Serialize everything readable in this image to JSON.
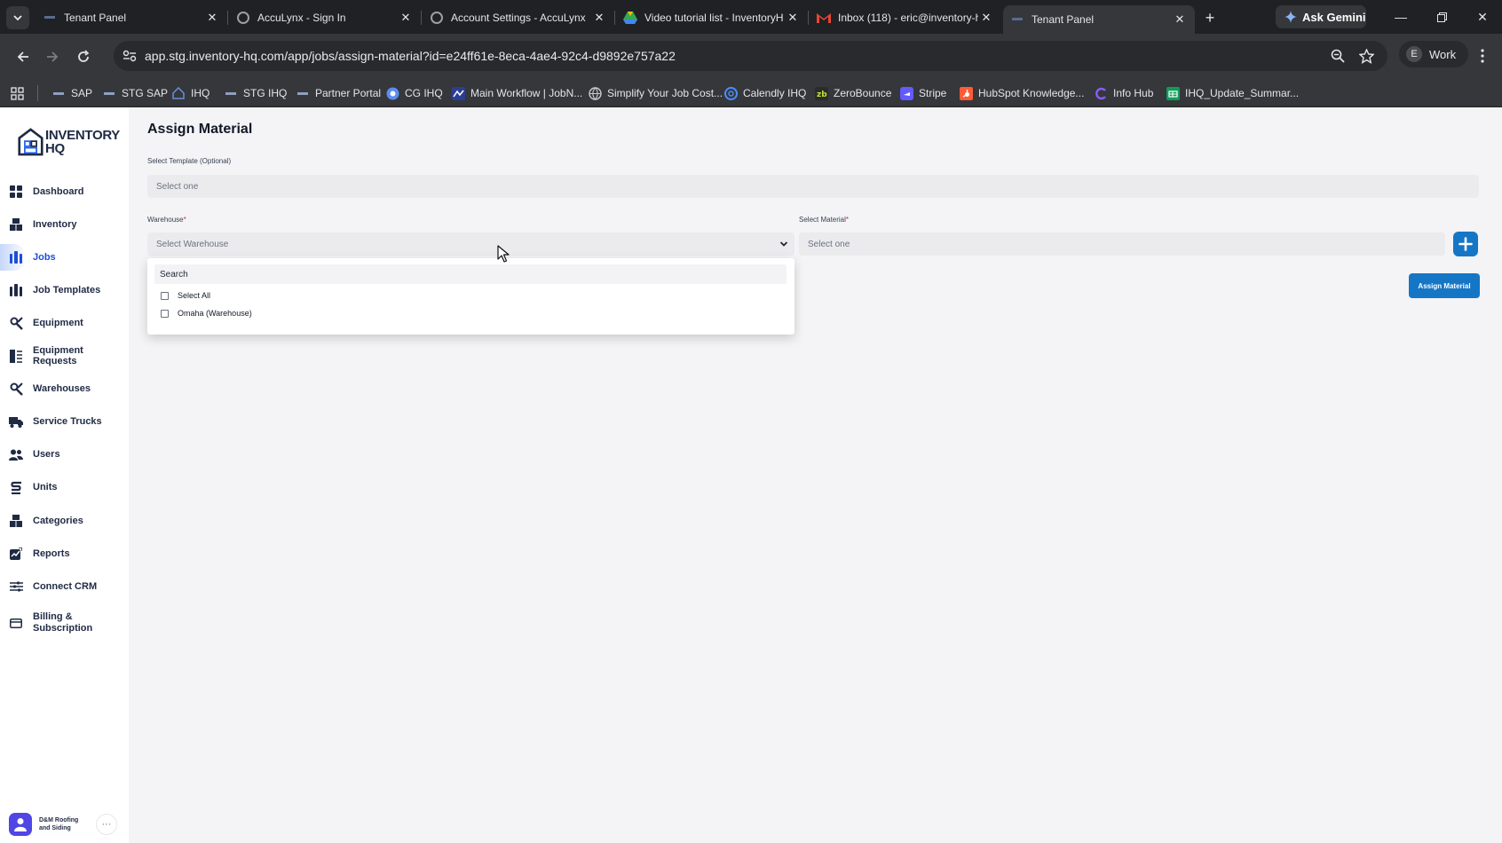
{
  "browser": {
    "tabs": [
      {
        "title": "Tenant Panel",
        "active": false
      },
      {
        "title": "AccuLynx - Sign In",
        "active": false
      },
      {
        "title": "Account Settings - AccuLynx",
        "active": false
      },
      {
        "title": "Video tutorial list - InventoryH",
        "active": false
      },
      {
        "title": "Inbox (118) - eric@inventory-h",
        "active": false
      },
      {
        "title": "Tenant Panel",
        "active": true
      }
    ],
    "gemini_label": "Ask Gemini",
    "url": "app.stg.inventory-hq.com/app/jobs/assign-material?id=e24ff61e-8eca-4ae4-92c4-d9892e757a22",
    "profile_initial": "E",
    "profile_label": "Work",
    "bookmarks": [
      "SAP",
      "STG SAP",
      "IHQ",
      "STG IHQ",
      "Partner Portal",
      "CG IHQ",
      "Main Workflow | JobN...",
      "Simplify Your Job Cost...",
      "Calendly IHQ",
      "ZeroBounce",
      "Stripe",
      "HubSpot Knowledge...",
      "Info Hub",
      "IHQ_Update_Summar..."
    ]
  },
  "sidebar": {
    "logo_line1": "INVENTORY",
    "logo_line2": "HQ",
    "items": [
      {
        "label": "Dashboard",
        "icon": "grid-icon"
      },
      {
        "label": "Inventory",
        "icon": "boxes-icon"
      },
      {
        "label": "Jobs",
        "icon": "jobs-icon",
        "active": true
      },
      {
        "label": "Job Templates",
        "icon": "templates-icon"
      },
      {
        "label": "Equipment",
        "icon": "tools-icon"
      },
      {
        "label": "Equipment Requests",
        "icon": "requests-icon"
      },
      {
        "label": "Warehouses",
        "icon": "warehouse-icon"
      },
      {
        "label": "Service Trucks",
        "icon": "truck-icon"
      },
      {
        "label": "Users",
        "icon": "users-icon"
      },
      {
        "label": "Units",
        "icon": "units-icon"
      },
      {
        "label": "Categories",
        "icon": "categories-icon"
      },
      {
        "label": "Reports",
        "icon": "reports-icon"
      },
      {
        "label": "Connect CRM",
        "icon": "crm-icon"
      },
      {
        "label": "Billing & Subscription",
        "icon": "billing-icon"
      }
    ],
    "tenant_name": "D&M Roofing and Siding",
    "tenant_more": "···"
  },
  "main": {
    "title": "Assign Material",
    "template_label": "Select Template (Optional)",
    "template_placeholder": "Select one",
    "warehouse_label": "Warehouse",
    "warehouse_placeholder": "Select Warehouse",
    "material_label": "Select Material",
    "material_placeholder": "Select one",
    "required_mark": "*",
    "assign_button": "Assign Material",
    "dropdown": {
      "search_placeholder": "Search",
      "options": [
        "Select All",
        "Omaha (Warehouse)"
      ]
    }
  },
  "colors": {
    "accent": "#1676c6",
    "active_nav": "#1d4ed8",
    "chrome_dark": "#1f2124"
  }
}
